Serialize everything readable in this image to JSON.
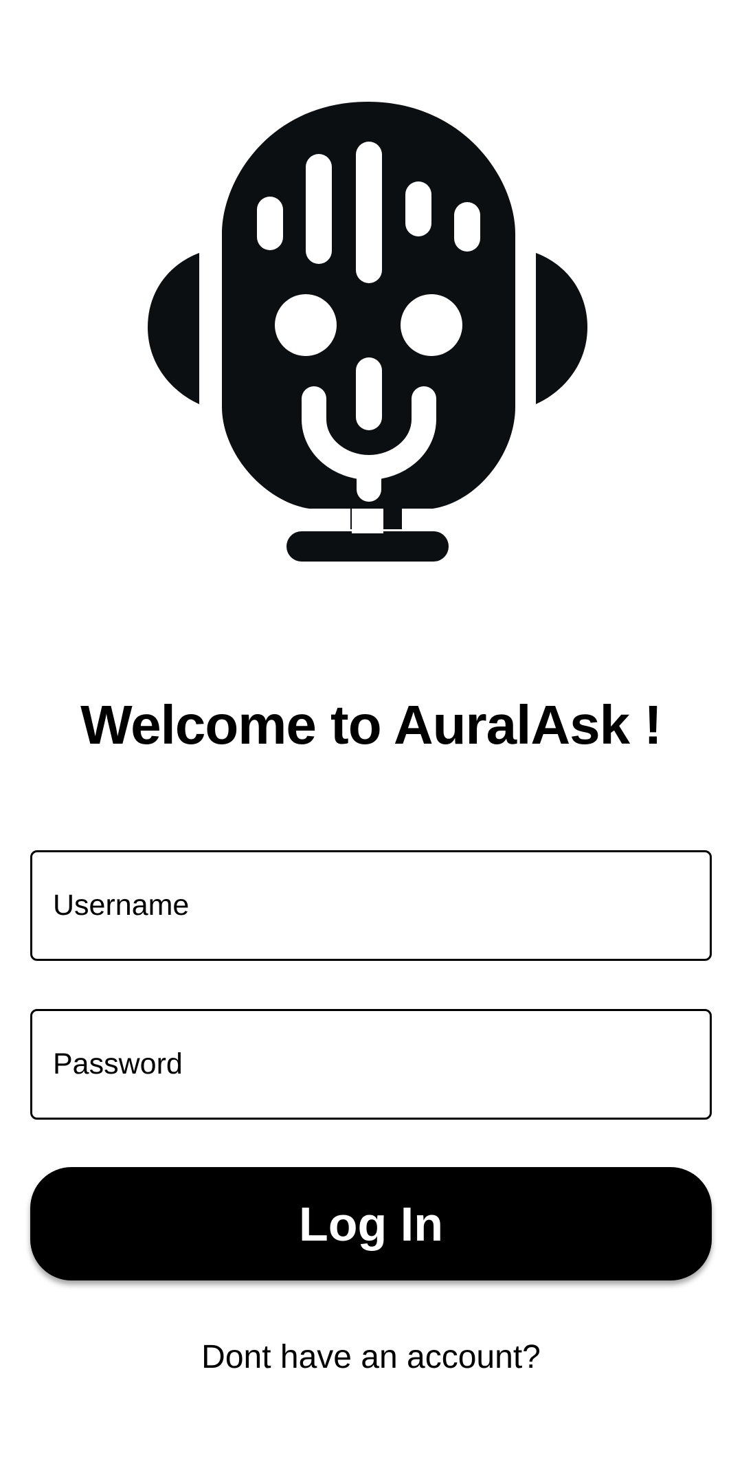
{
  "app": {
    "logo_icon": "podcast-microphone-head-icon",
    "title": "Welcome to AuralAsk !"
  },
  "form": {
    "username_placeholder": "Username",
    "password_placeholder": "Password",
    "login_label": "Log In",
    "signup_prompt": "Dont have an account?"
  },
  "colors": {
    "primary": "#000000",
    "logo_fill": "#0b0f12",
    "background": "#ffffff",
    "button_text": "#ffffff"
  }
}
